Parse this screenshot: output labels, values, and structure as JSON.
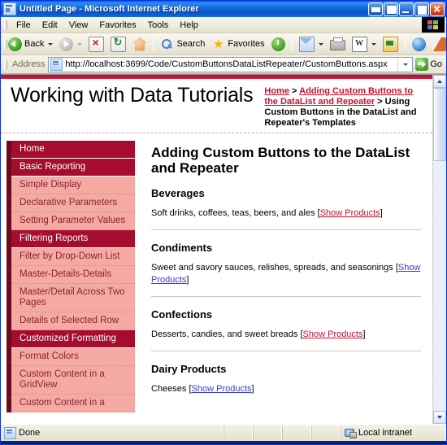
{
  "window": {
    "title": "Untitled Page - Microsoft Internet Explorer",
    "icon": "ie-page-icon",
    "buttons": [
      {
        "name": "restore-group-button",
        "label": ""
      },
      {
        "name": "dock-button",
        "label": ""
      },
      {
        "name": "minimize-button",
        "label": ""
      },
      {
        "name": "maximize-button",
        "label": ""
      },
      {
        "name": "close-button",
        "label": ""
      }
    ]
  },
  "menubar": {
    "items": [
      {
        "label": "File"
      },
      {
        "label": "Edit"
      },
      {
        "label": "View"
      },
      {
        "label": "Favorites"
      },
      {
        "label": "Tools"
      },
      {
        "label": "Help"
      }
    ]
  },
  "toolbar": {
    "back_label": "Back",
    "search_label": "Search",
    "favorites_label": "Favorites",
    "edit_glyph": "W",
    "buttons": [
      {
        "name": "back-button",
        "icon": "back-arrow-icon",
        "label": "Back"
      },
      {
        "name": "forward-button",
        "icon": "forward-arrow-icon",
        "label": ""
      },
      {
        "name": "stop-button",
        "icon": "stop-icon",
        "label": ""
      },
      {
        "name": "refresh-button",
        "icon": "refresh-icon",
        "label": ""
      },
      {
        "name": "home-button",
        "icon": "home-icon",
        "label": ""
      },
      {
        "name": "search-button",
        "icon": "search-icon",
        "label": "Search"
      },
      {
        "name": "favorites-button",
        "icon": "star-icon",
        "label": "Favorites"
      },
      {
        "name": "history-button",
        "icon": "history-icon",
        "label": ""
      },
      {
        "name": "mail-button",
        "icon": "mail-icon",
        "label": ""
      },
      {
        "name": "print-button",
        "icon": "printer-icon",
        "label": ""
      },
      {
        "name": "edit-button",
        "icon": "word-edit-icon",
        "label": ""
      },
      {
        "name": "discuss-button",
        "icon": "discuss-icon",
        "label": ""
      },
      {
        "name": "msn-button",
        "icon": "msn-icon",
        "label": ""
      },
      {
        "name": "messenger-button",
        "icon": "messenger-icon",
        "label": ""
      },
      {
        "name": "media-button",
        "icon": "media-icon",
        "label": ""
      },
      {
        "name": "grid-button",
        "icon": "grid-icon",
        "label": ""
      }
    ]
  },
  "address": {
    "label": "Address",
    "url": "http://localhost:3699/Code/CustomButtonsDataListRepeater/CustomButtons.aspx",
    "go_label": "Go"
  },
  "page": {
    "site_title": "Working with Data Tutorials",
    "breadcrumb": {
      "home": "Home",
      "sep1": " > ",
      "parent": "Adding Custom Buttons to the DataList and Repeater",
      "sep2": " > ",
      "current": "Using Custom Buttons in the DataList and Repeater's Templates"
    },
    "heading": "Adding Custom Buttons to the DataList and Repeater",
    "sidebar": [
      {
        "label": "Home",
        "type": "section"
      },
      {
        "label": "Basic Reporting",
        "type": "section"
      },
      {
        "label": "Simple Display",
        "type": "sub"
      },
      {
        "label": "Declarative Parameters",
        "type": "sub"
      },
      {
        "label": "Setting Parameter Values",
        "type": "sub"
      },
      {
        "label": "Filtering Reports",
        "type": "section"
      },
      {
        "label": "Filter by Drop-Down List",
        "type": "sub"
      },
      {
        "label": "Master-Details-Details",
        "type": "sub"
      },
      {
        "label": "Master/Detail Across Two Pages",
        "type": "sub"
      },
      {
        "label": "Details of Selected Row",
        "type": "sub"
      },
      {
        "label": "Customized Formatting",
        "type": "section"
      },
      {
        "label": "Format Colors",
        "type": "sub"
      },
      {
        "label": "Custom Content in a GridView",
        "type": "sub"
      },
      {
        "label": "Custom Content in a",
        "type": "sub"
      }
    ],
    "categories": [
      {
        "name": "Beverages",
        "description": "Soft drinks, coffees, teas, beers, and ales",
        "link_open": "[",
        "link": "Show Products",
        "link_close": "]",
        "link_state": "unvisited"
      },
      {
        "name": "Condiments",
        "description": "Sweet and savory sauces, relishes, spreads, and seasonings",
        "link_open": "[",
        "link": "Show Products",
        "link_close": "]",
        "link_state": "visited"
      },
      {
        "name": "Confections",
        "description": "Desserts, candies, and sweet breads",
        "link_open": "[",
        "link": "Show Products",
        "link_close": "]",
        "link_state": "unvisited"
      },
      {
        "name": "Dairy Products",
        "description": "Cheeses",
        "link_open": "[",
        "link": "Show Products",
        "link_close": "]",
        "link_state": "visited"
      }
    ]
  },
  "statusbar": {
    "status": "Done",
    "zone": "Local intranet",
    "zone_icon": "local-intranet-icon"
  },
  "colors": {
    "brand_red": "#c8102e",
    "nav_section_bg": "#a50c2e",
    "nav_sub_bg": "#f4a9a3",
    "nav_rail": "#6e0a20",
    "link_visited": "#3b3bd0",
    "titlebar_blue": "#1668dd"
  }
}
